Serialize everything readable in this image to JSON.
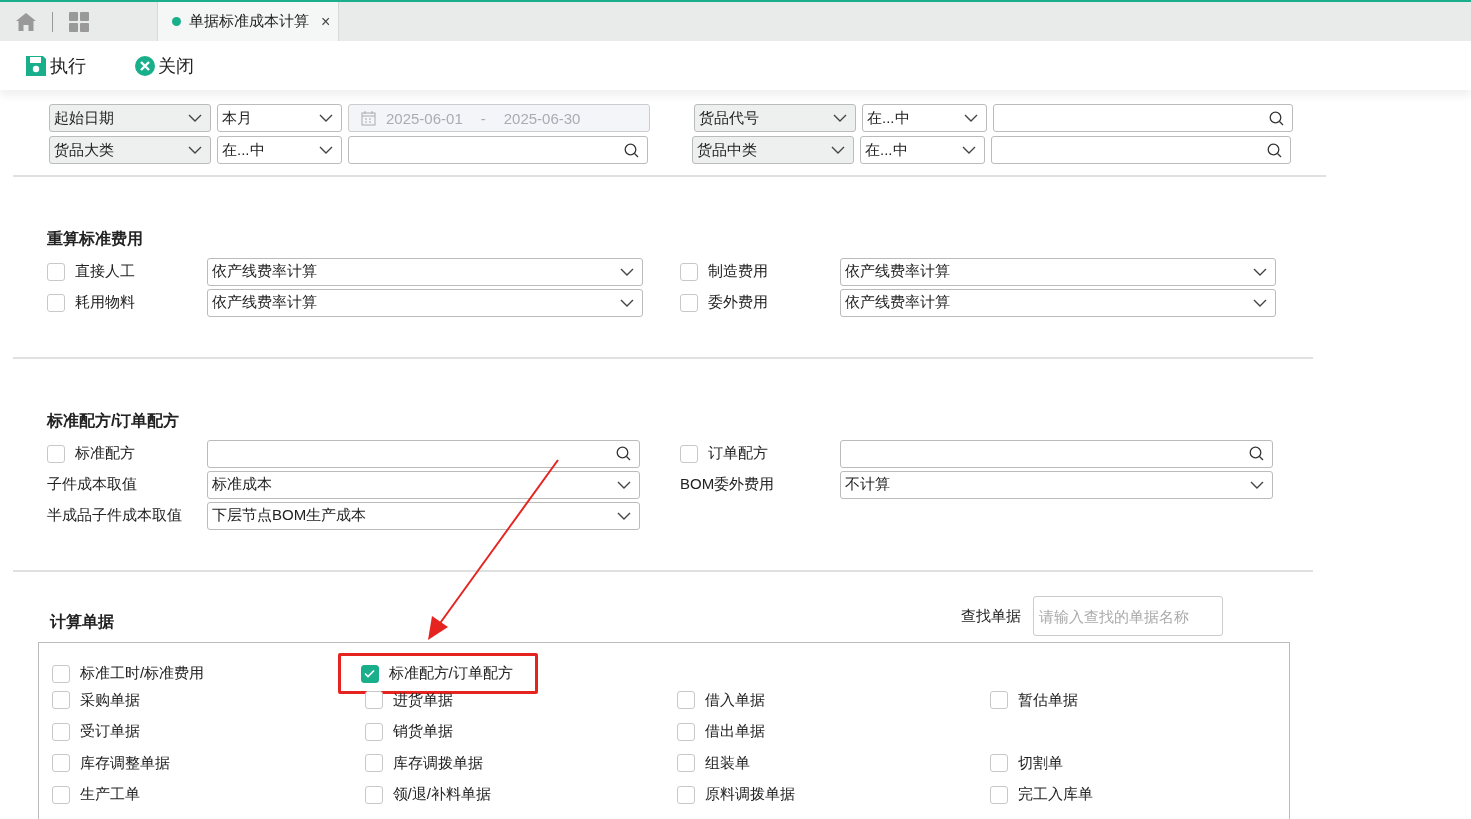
{
  "tabs": [
    {
      "kind": "home",
      "selected": false
    },
    {
      "kind": "apps",
      "selected": false
    },
    {
      "kind": "page",
      "label": "单据标准成本计算",
      "close": "×",
      "selected": true
    }
  ],
  "toolbar": [
    {
      "kind": "save",
      "label": "执行"
    },
    {
      "kind": "close",
      "label": "关闭"
    }
  ],
  "filter_rows": [
    {
      "left": [
        {
          "kind": "field",
          "value": "起始日期"
        },
        {
          "kind": "operator",
          "value": "本月"
        },
        {
          "kind": "date_range",
          "from": "2025-06-01",
          "separator": "-",
          "to": "2025-06-30",
          "disabled": true
        }
      ],
      "right": [
        {
          "kind": "field",
          "value": "货品代号"
        },
        {
          "kind": "operator",
          "value": "在...中"
        },
        {
          "kind": "search"
        }
      ]
    },
    {
      "left": [
        {
          "kind": "field",
          "value": "货品大类"
        },
        {
          "kind": "operator",
          "value": "在...中"
        },
        {
          "kind": "search"
        }
      ],
      "right": [
        {
          "kind": "field",
          "value": "货品中类"
        },
        {
          "kind": "operator",
          "value": "在...中"
        },
        {
          "kind": "search"
        }
      ]
    }
  ],
  "recalc": {
    "title": "重算标准费用",
    "rows": [
      {
        "left": {
          "kind": "check_select",
          "label": "直接人工",
          "checked": false,
          "value": "依产线费率计算"
        },
        "right": {
          "kind": "check_select",
          "label": "制造费用",
          "checked": false,
          "value": "依产线费率计算"
        }
      },
      {
        "left": {
          "kind": "check_select",
          "label": "耗用物料",
          "checked": false,
          "value": "依产线费率计算"
        },
        "right": {
          "kind": "check_select",
          "label": "委外费用",
          "checked": false,
          "value": "依产线费率计算"
        }
      }
    ]
  },
  "formula": {
    "title": "标准配方/订单配方",
    "rows": [
      {
        "left": {
          "kind": "check_search",
          "label": "标准配方",
          "checked": false
        },
        "right": {
          "kind": "check_search",
          "label": "订单配方",
          "checked": false
        }
      },
      {
        "left": {
          "kind": "label_select",
          "label": "子件成本取值",
          "value": "标准成本"
        },
        "right": {
          "kind": "label_select",
          "label": "BOM委外费用",
          "value": "不计算"
        }
      },
      {
        "left": {
          "kind": "label_select",
          "label": "半成品子件成本取值",
          "value": "下层节点BOM生产成本"
        }
      }
    ]
  },
  "documents": {
    "title": "计算单据",
    "search_label": "查找单据",
    "search_placeholder": "请输入查找的单据名称",
    "rows": [
      [
        {
          "label": "标准工时/标准费用",
          "checked": false,
          "highlighted": false
        },
        {
          "label": "标准配方/订单配方",
          "checked": true,
          "highlighted": true
        }
      ],
      [
        {
          "label": "采购单据",
          "checked": false,
          "highlighted": false
        },
        {
          "label": "进货单据",
          "checked": false,
          "highlighted": false
        },
        {
          "label": "借入单据",
          "checked": false,
          "highlighted": false
        },
        {
          "label": "暂估单据",
          "checked": false,
          "highlighted": false
        }
      ],
      [
        {
          "label": "受订单据",
          "checked": false,
          "highlighted": false
        },
        {
          "label": "销货单据",
          "checked": false,
          "highlighted": false
        },
        {
          "label": "借出单据",
          "checked": false,
          "highlighted": false
        }
      ],
      [
        {
          "label": "库存调整单据",
          "checked": false,
          "highlighted": false
        },
        {
          "label": "库存调拨单据",
          "checked": false,
          "highlighted": false
        },
        {
          "label": "组装单",
          "checked": false,
          "highlighted": false
        },
        {
          "label": "切割单",
          "checked": false,
          "highlighted": false
        }
      ],
      [
        {
          "label": "生产工单",
          "checked": false,
          "highlighted": false
        },
        {
          "label": "领/退/补料单据",
          "checked": false,
          "highlighted": false
        },
        {
          "label": "原料调拨单据",
          "checked": false,
          "highlighted": false
        },
        {
          "label": "完工入库单",
          "checked": false,
          "highlighted": false
        }
      ]
    ]
  }
}
